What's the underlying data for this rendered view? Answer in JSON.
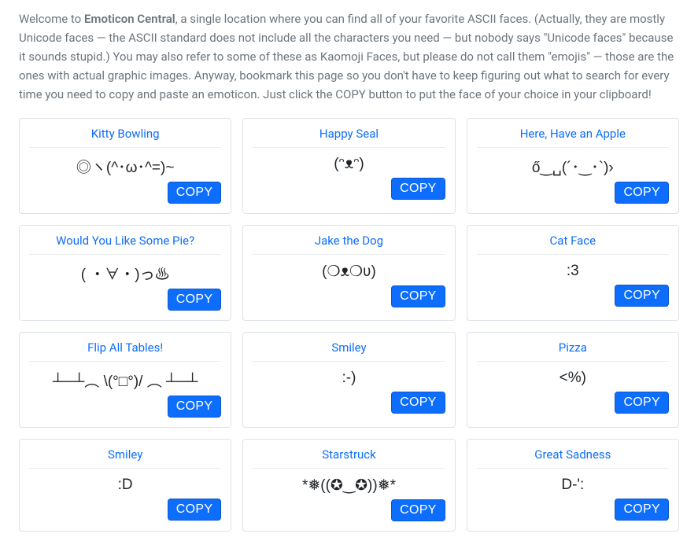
{
  "intro": {
    "prefix": "Welcome to ",
    "brand": "Emoticon Central",
    "rest": ", a single location where you can find all of your favorite ASCII faces. (Actually, they are mostly Unicode faces — the ASCII standard does not include all the characters you need — but nobody says \"Unicode faces\" because it sounds stupid.) You may also refer to some of these as Kaomoji Faces, but please do not call them \"emojis\" — those are the ones with actual graphic images. Anyway, bookmark this page so you don't have to keep figuring out what to search for every time you need to copy and paste an emoticon. Just click the COPY button to put the face of your choice in your clipboard!"
  },
  "copy_label": "COPY",
  "cards": [
    {
      "title": "Kitty Bowling",
      "face": "◎ヽ(^･ω･^=)~"
    },
    {
      "title": "Happy Seal",
      "face": "(ᵔᴥᵔ)"
    },
    {
      "title": "Here, Have an Apple",
      "face": "ő‿␣(´･‿･`)›"
    },
    {
      "title": "Would You Like Some Pie?",
      "face": "( ・∀・)っ♨"
    },
    {
      "title": "Jake the Dog",
      "face": "(❍ᴥ❍ʋ)"
    },
    {
      "title": "Cat Face",
      "face": ":3"
    },
    {
      "title": "Flip All Tables!",
      "face": "┴─┴︵ \\(°□°)/ ︵ ┴─┴"
    },
    {
      "title": "Smiley",
      "face": ":-)"
    },
    {
      "title": "Pizza",
      "face": "<%)"
    },
    {
      "title": "Smiley",
      "face": ":D"
    },
    {
      "title": "Starstruck",
      "face": "*❅((✪‿✪))❅*"
    },
    {
      "title": "Great Sadness",
      "face": "D-':"
    }
  ]
}
